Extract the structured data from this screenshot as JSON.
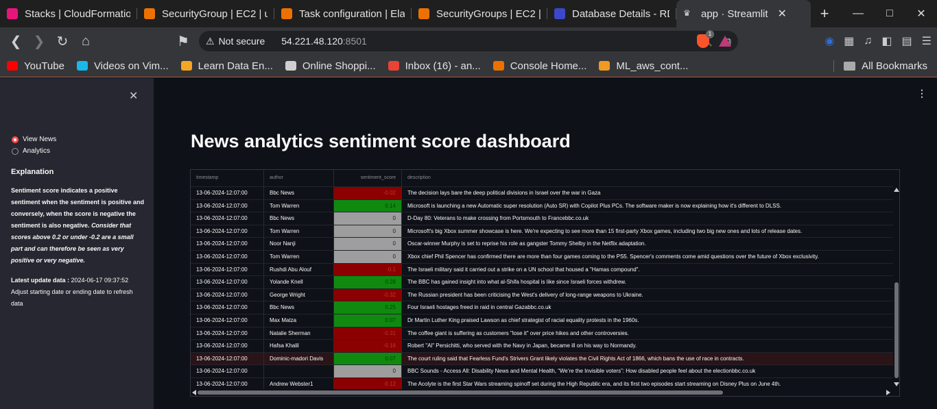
{
  "browser": {
    "tabs": [
      {
        "title": "Stacks | CloudFormatio",
        "icon": "cloudformation-icon",
        "color": "#e7157b"
      },
      {
        "title": "SecurityGroup | EC2 | u",
        "icon": "ec2-icon",
        "color": "#ed7100"
      },
      {
        "title": "Task configuration | Ela",
        "icon": "elastic-icon",
        "color": "#ed7100"
      },
      {
        "title": "SecurityGroups | EC2 |",
        "icon": "ec2-icon",
        "color": "#ed7100"
      },
      {
        "title": "Database Details - RDS",
        "icon": "rds-icon",
        "color": "#3b48cc"
      },
      {
        "title": "app · Streamlit",
        "icon": "streamlit-icon",
        "color": "#35363a",
        "active": true
      }
    ],
    "address": {
      "security_label": "Not secure",
      "host": "54.221.48.120",
      "port": ":8501"
    },
    "brave_badge": "1",
    "bookmarks": [
      {
        "label": "YouTube",
        "icon": "youtube-icon",
        "color": "#ff0000"
      },
      {
        "label": "Videos on Vim...",
        "icon": "vimeo-icon",
        "color": "#1ab7ea"
      },
      {
        "label": "Learn Data En...",
        "icon": "chevron-left-icon",
        "color": "#f5a623"
      },
      {
        "label": "Online Shoppi...",
        "icon": "shopping-icon",
        "color": "#d0d0d0"
      },
      {
        "label": "Inbox (16) - an...",
        "icon": "gmail-icon",
        "color": "#ea4335"
      },
      {
        "label": "Console Home...",
        "icon": "aws-cube-icon",
        "color": "#ed7100"
      },
      {
        "label": "ML_aws_cont...",
        "icon": "ml-icon",
        "color": "#f09a22"
      }
    ],
    "all_bookmarks": "All Bookmarks"
  },
  "sidebar": {
    "radio_options": [
      {
        "label": "View News",
        "selected": true
      },
      {
        "label": "Analytics",
        "selected": false
      }
    ],
    "explanation_heading": "Explanation",
    "explanation_bold": "Sentiment score indicates a positive sentiment when the sentiment is positive and conversely, when the score is negative the sentiment is also negative.",
    "explanation_italic": "Consider that scores above 0.2 or under -0.2 are a small part and can therefore be seen as very positive or very negative.",
    "update_label": "Latest update data :",
    "update_value": " 2024-06-17 09:37:52",
    "update_note": "Adjust starting date or ending date to refresh data"
  },
  "main": {
    "title": "News analytics sentiment score dashboard",
    "columns": [
      "timestamp",
      "author",
      "sentiment_score",
      "description"
    ],
    "colors": {
      "positive": "#0f8a0f",
      "negative": "#8b0000",
      "neutral": "#9e9e9e"
    },
    "rows": [
      {
        "timestamp": "13-06-2024-12:07:00",
        "author": "Bbc News",
        "score": "-0.02",
        "tone": "negative",
        "description": "The decision lays bare the deep political divisions in Israel over the war in Gaza"
      },
      {
        "timestamp": "13-06-2024-12:07:00",
        "author": "Tom Warren",
        "score": "0.14",
        "tone": "positive",
        "description": "Microsoft is launching a new Automatic super resolution (Auto SR) with Copilot Plus PCs. The software maker is now explaining how it's different to DLSS."
      },
      {
        "timestamp": "13-06-2024-12:07:00",
        "author": "Bbc News",
        "score": "0",
        "tone": "neutral",
        "description": "D-Day 80: Veterans to make crossing from Portsmouth to Francebbc.co.uk"
      },
      {
        "timestamp": "13-06-2024-12:07:00",
        "author": "Tom Warren",
        "score": "0",
        "tone": "neutral",
        "description": "Microsoft's big Xbox summer showcase is here. We're expecting to see more than 15 first-party Xbox games, including two big new ones and lots of release dates."
      },
      {
        "timestamp": "13-06-2024-12:07:00",
        "author": "Noor Nanji",
        "score": "0",
        "tone": "neutral",
        "description": "Oscar-winner Murphy is set to reprise his role as gangster Tommy Shelby in the Netflix adaptation."
      },
      {
        "timestamp": "13-06-2024-12:07:00",
        "author": "Tom Warren",
        "score": "0",
        "tone": "neutral",
        "description": "Xbox chief Phil Spencer has confirmed there are more than four games coming to the PS5. Spencer's comments come amid questions over the future of Xbox exclusivity."
      },
      {
        "timestamp": "13-06-2024-12:07:00",
        "author": "Rushdi Abu Alouf",
        "score": "-0.1",
        "tone": "negative",
        "description": "The Israeli military said it carried out a strike on a UN school that housed a \"Hamas compound\"."
      },
      {
        "timestamp": "13-06-2024-12:07:00",
        "author": "Yolande Knell",
        "score": "0.28",
        "tone": "positive",
        "description": "The BBC has gained insight into what al-Shifa hospital is like since Israeli forces withdrew."
      },
      {
        "timestamp": "13-06-2024-12:07:00",
        "author": "George Wright",
        "score": "-0.32",
        "tone": "negative",
        "description": "The Russian president has been criticising the West's delivery of long-range weapons to Ukraine."
      },
      {
        "timestamp": "13-06-2024-12:07:00",
        "author": "Bbc News",
        "score": "0.25",
        "tone": "positive",
        "description": "Four Israeli hostages freed in raid in central Gazabbc.co.uk"
      },
      {
        "timestamp": "13-06-2024-12:07:00",
        "author": "Max Matza",
        "score": "0.07",
        "tone": "positive",
        "description": "Dr Martin Luther King praised Lawson as chief strategist of racial equality protests in the 1960s."
      },
      {
        "timestamp": "13-06-2024-12:07:00",
        "author": "Natalie Sherman",
        "score": "-0.31",
        "tone": "negative",
        "description": "The coffee giant is suffering as customers \"lose it\" over price hikes and other controversies."
      },
      {
        "timestamp": "13-06-2024-12:07:00",
        "author": "Hafsa Khalil",
        "score": "-0.16",
        "tone": "negative",
        "description": "Robert \"Al\" Persichitti, who served with the Navy in Japan, became ill on his way to Normandy."
      },
      {
        "timestamp": "13-06-2024-12:07:00",
        "author": "Dominic-madori Davis",
        "score": "0.07",
        "tone": "positive",
        "highlight": true,
        "description": "The court ruling said that Fearless Fund's Strivers Grant likely violates the Civil Rights Act of 1866, which bans the use of race in contracts."
      },
      {
        "timestamp": "13-06-2024-12:07:00",
        "author": "",
        "score": "0",
        "tone": "neutral",
        "description": "BBC Sounds - Access All: Disability News and Mental Health, “We’re the Invisible voters”: How disabled people feel about the electionbbc.co.uk"
      },
      {
        "timestamp": "13-06-2024-12:07:00",
        "author": "Andrew Webster1",
        "score": "-0.12",
        "tone": "negative",
        "description": "The Acolyte is the first Star Wars streaming spinoff set during the High Republic era, and its first two episodes start streaming on Disney Plus on June 4th."
      }
    ]
  }
}
